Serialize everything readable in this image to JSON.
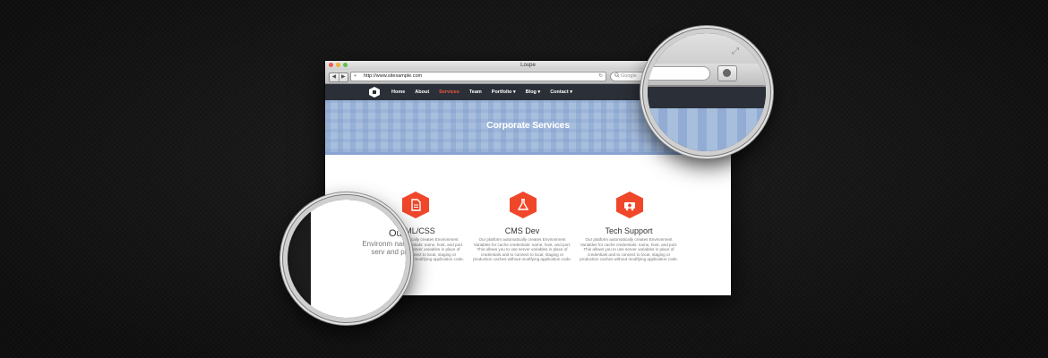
{
  "window": {
    "title": "Loupe"
  },
  "toolbar": {
    "back": "◀",
    "forward": "▶",
    "add": "+",
    "url": "http://www.sitexample.com",
    "reload": "↻",
    "search_placeholder": "Google",
    "search_icon": "search-icon"
  },
  "nav": {
    "items": [
      "Home",
      "About",
      "Services",
      "Team",
      "Portfolio ▾",
      "Blog ▾",
      "Contact ▾"
    ],
    "active_index": 2
  },
  "hero": {
    "title": "Corporate Services"
  },
  "services": [
    {
      "icon": "document-icon",
      "title": "HTML/CSS",
      "text": "Our platform automatically creates Environment Variables for cache credentials: name, host, and port. This allows you to use server variables in place of credentials and to connect to local, staging or production caches without modifying application code."
    },
    {
      "icon": "flask-icon",
      "title": "CMS Dev",
      "text": "Our platform automatically creates Environment Variables for cache credentials: name, host, and port. This allows you to use server variables in place of credentials and to connect to local, staging or production caches without modifying application code."
    },
    {
      "icon": "ambulance-icon",
      "title": "Tech Support",
      "text": "Our platform automatically creates Environment Variables for cache credentials: name, host, and port. This allows you to use server variables in place of credentials and to connect to local, staging or production caches without modifying application code."
    }
  ],
  "loupe": {
    "title_fragment": "Ou ML/CSS",
    "text_fragment": "Environm name, use serv and produ"
  },
  "colors": {
    "accent": "#f0472b",
    "nav_bg": "#2b2f37",
    "hero_bg": "#a7bedd",
    "active_link": "#f2583e"
  }
}
